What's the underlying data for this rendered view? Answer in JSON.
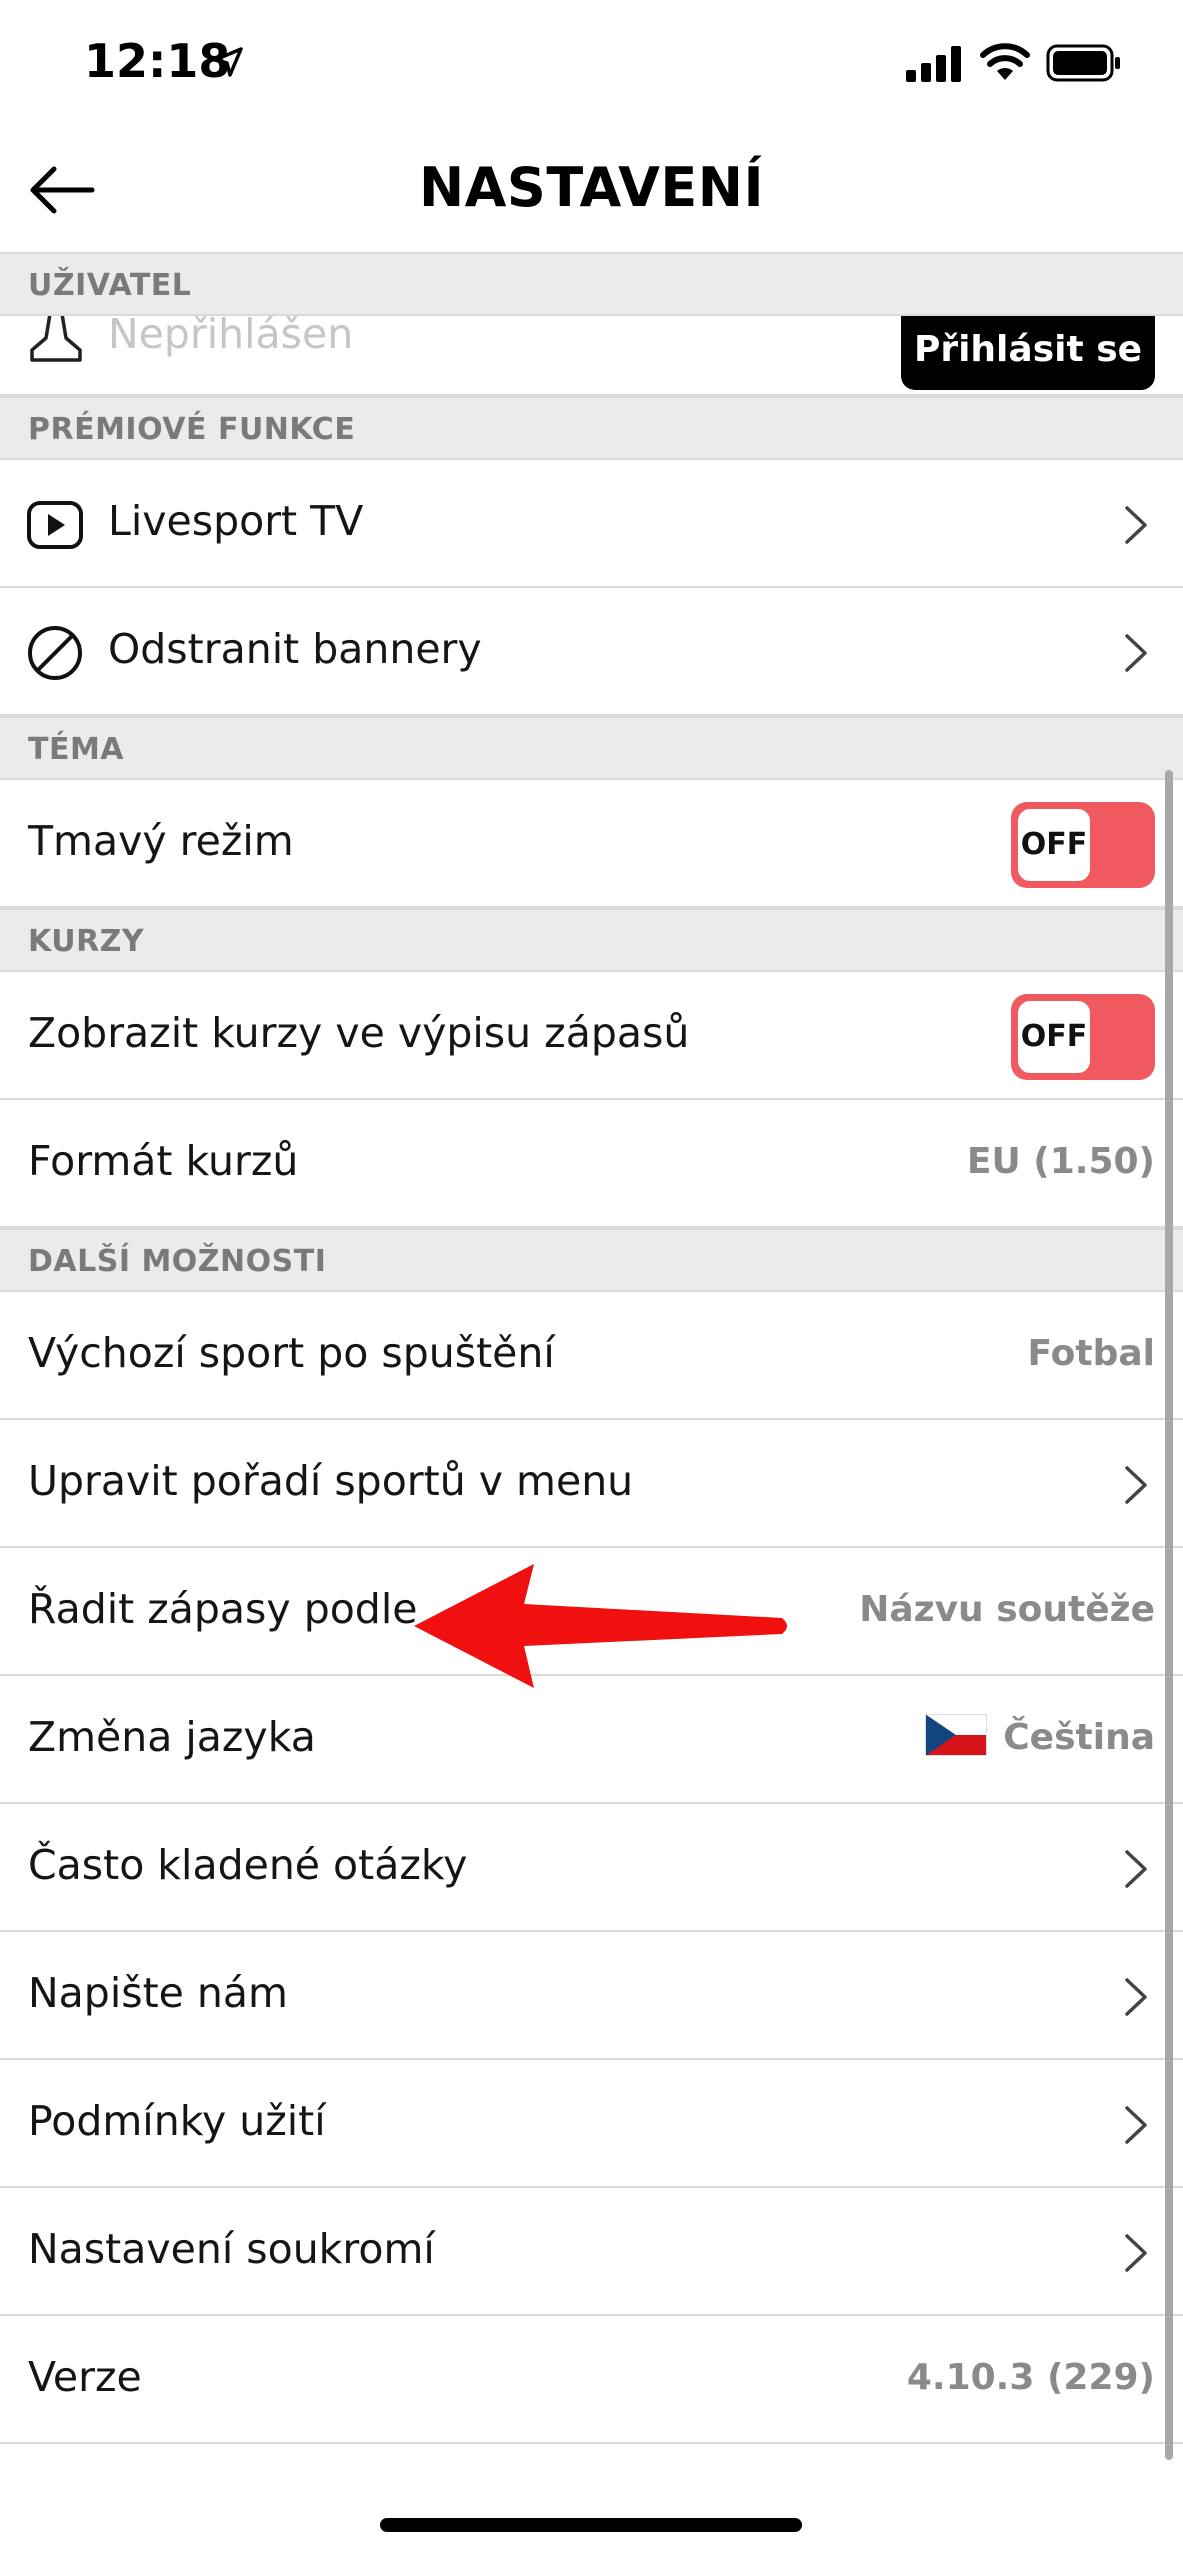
{
  "status_bar": {
    "time": "12:18",
    "location_icon": "location-arrow-icon",
    "signal_icon": "cellular-signal-icon",
    "wifi_icon": "wifi-icon",
    "battery_icon": "battery-icon"
  },
  "navbar": {
    "back_icon": "arrow-left-icon",
    "title": "NASTAVENÍ"
  },
  "sections": {
    "user": {
      "header": "UŽIVATEL",
      "status": "Nepřihlášen",
      "login_label": "Přihlásit se",
      "icon": "user-icon"
    },
    "premium": {
      "header": "PRÉMIOVÉ FUNKCE",
      "items": [
        {
          "label": "Livesport TV",
          "icon": "play-icon"
        },
        {
          "label": "Odstranit bannery",
          "icon": "no-ads-icon"
        }
      ]
    },
    "theme": {
      "header": "TÉMA",
      "dark_mode_label": "Tmavý režim",
      "dark_mode_state": "OFF"
    },
    "odds": {
      "header": "KURZY",
      "show_odds_label": "Zobrazit kurzy ve výpisu zápasů",
      "show_odds_state": "OFF",
      "format_label": "Formát kurzů",
      "format_value": "EU (1.50)"
    },
    "more": {
      "header": "DALŠÍ MOŽNOSTI",
      "default_sport_label": "Výchozí sport po spuštění",
      "default_sport_value": "Fotbal",
      "sport_order_label": "Upravit pořadí sportů v menu",
      "sort_label": "Řadit zápasy podle",
      "sort_value": "Názvu soutěže",
      "language_label": "Změna jazyka",
      "language_value": "Čeština",
      "faq_label": "Často kladené otázky",
      "contact_label": "Napište nám",
      "terms_label": "Podmínky užití",
      "privacy_label": "Nastavení soukromí",
      "version_label": "Verze",
      "version_value": "4.10.3 (229)"
    }
  },
  "colors": {
    "toggle_off": "#f05a5e",
    "section_bg": "#ebebeb",
    "annotation_arrow": "#f01010"
  }
}
